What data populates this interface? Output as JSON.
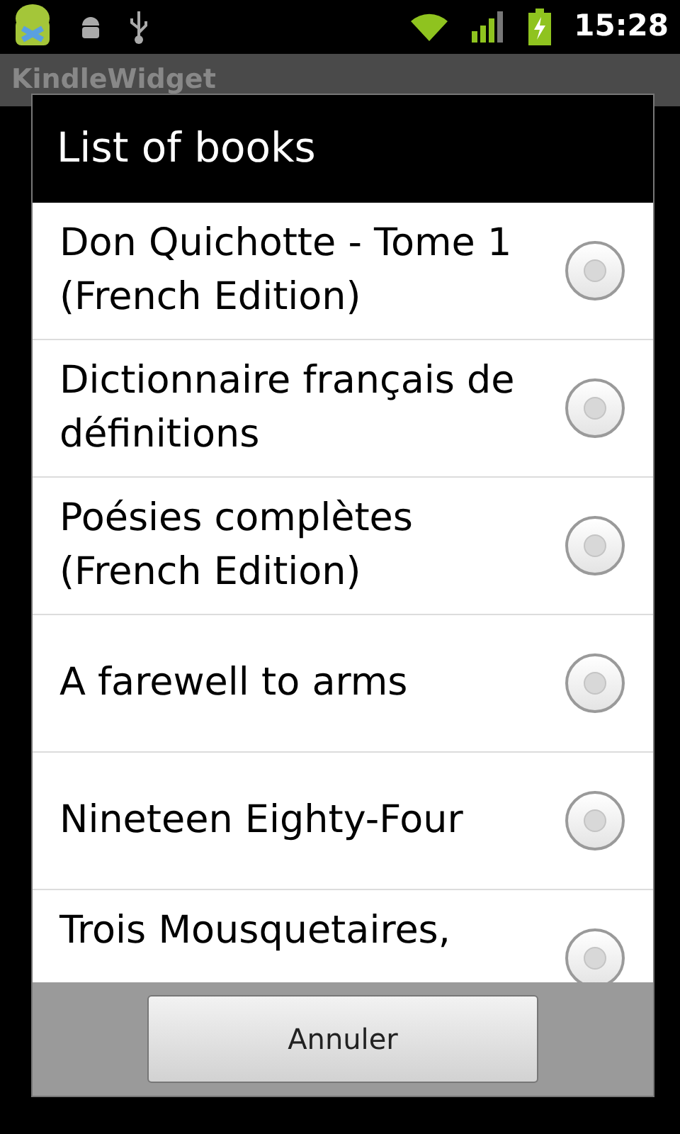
{
  "status_bar": {
    "time": "15:28"
  },
  "app": {
    "title": "KindleWidget"
  },
  "dialog": {
    "title": "List of books",
    "items": [
      {
        "label": "Don Quichotte - Tome 1 (French Edition)",
        "selected": false
      },
      {
        "label": "Dictionnaire français de définitions",
        "selected": false
      },
      {
        "label": "Poésies complètes (French Edition)",
        "selected": false
      },
      {
        "label": "A farewell to arms",
        "selected": false
      },
      {
        "label": "Nineteen Eighty-Four",
        "selected": false
      },
      {
        "label": "Trois Mousquetaires,",
        "selected": false
      }
    ],
    "buttons": [
      "Annuler"
    ]
  }
}
